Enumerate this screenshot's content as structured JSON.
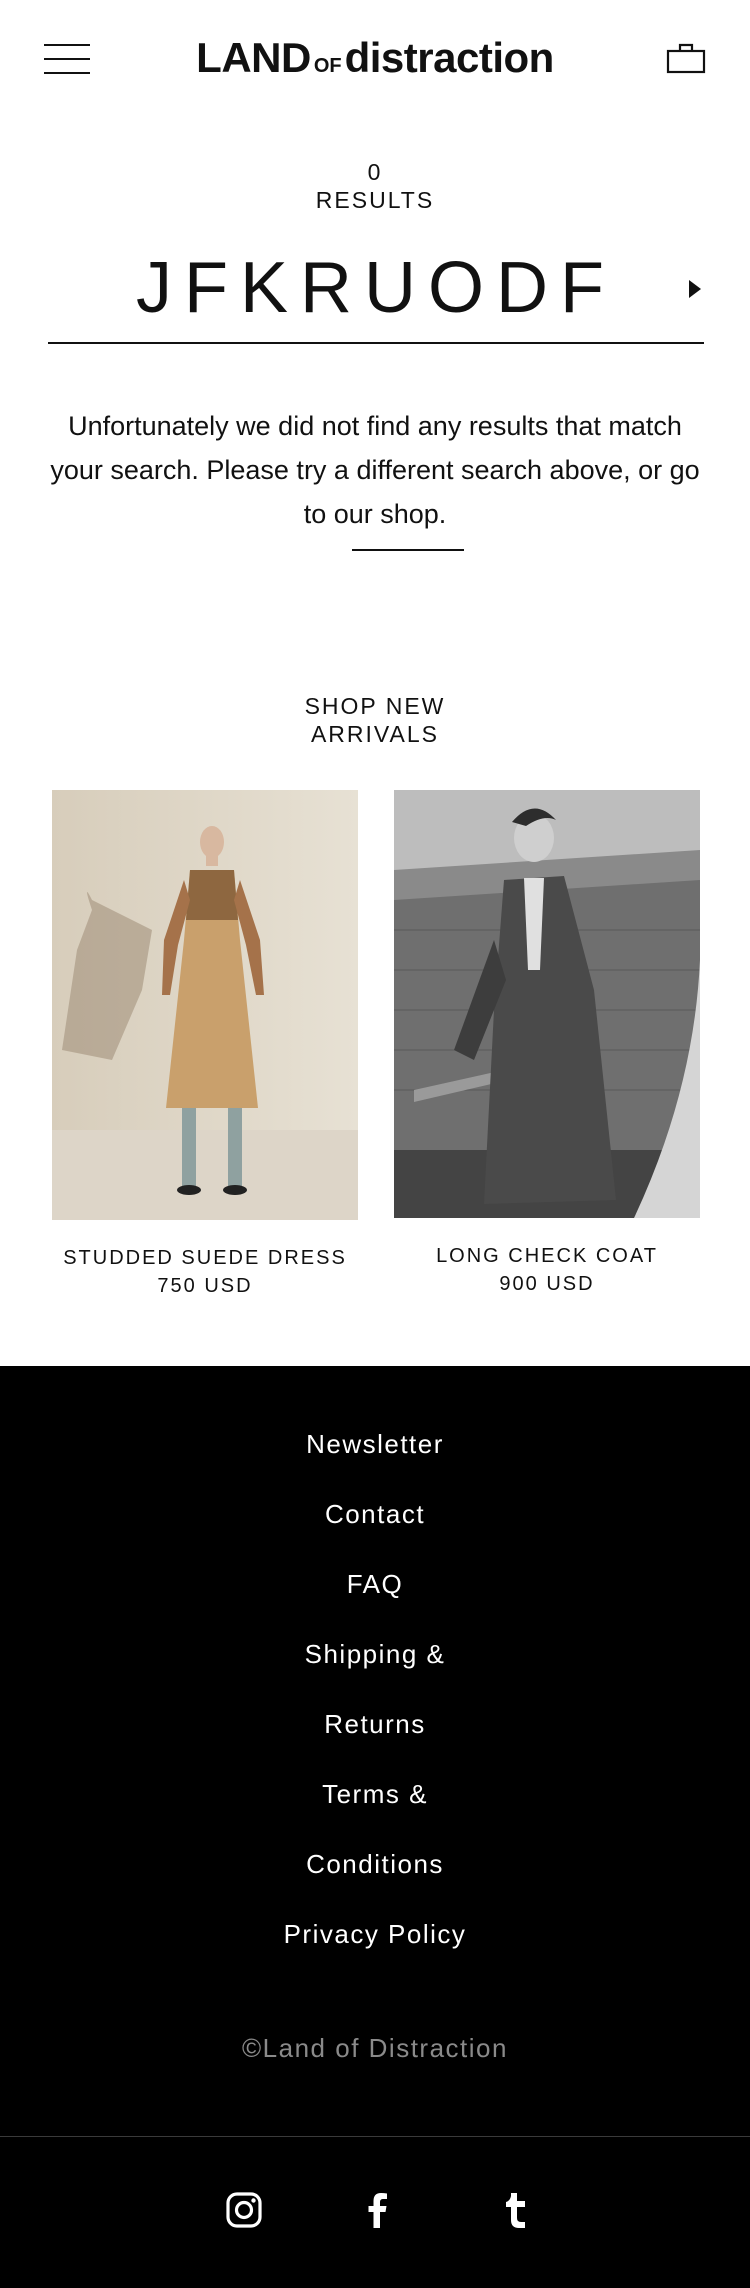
{
  "header": {
    "logo_land": "LAND",
    "logo_of": "OF",
    "logo_distraction": "distraction",
    "menu_icon": "hamburger-menu-icon",
    "bag_icon": "shopping-bag-icon"
  },
  "search": {
    "count": "0",
    "results_label": "RESULTS",
    "query": "JFKRUODF",
    "submit_icon": "arrow-right-icon",
    "message": "Unfortunately we did not find any results that match your search. Please try a different search above, or go to our shop."
  },
  "new_arrivals": {
    "title_line1": "SHOP NEW",
    "title_line2": "ARRIVALS",
    "products": [
      {
        "name": "STUDDED SUEDE DRESS",
        "price": "750 USD"
      },
      {
        "name": "LONG CHECK COAT",
        "price": "900 USD"
      }
    ]
  },
  "footer": {
    "links": [
      "Newsletter",
      "Contact",
      "FAQ",
      "Shipping &",
      "Returns",
      "Terms &",
      "Conditions",
      "Privacy Policy"
    ],
    "copyright": "©Land of Distraction",
    "social_icons": [
      "instagram-icon",
      "facebook-icon",
      "tumblr-icon"
    ]
  },
  "colors": {
    "text": "#111111",
    "background": "#ffffff",
    "footer_bg": "#000000",
    "footer_text": "#ffffff",
    "copyright_text": "#8a8a8a"
  }
}
